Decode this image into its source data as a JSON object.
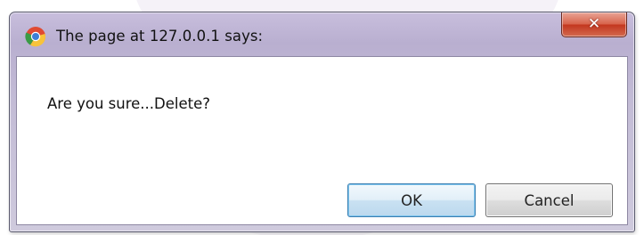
{
  "dialog": {
    "title": "The page at 127.0.0.1 says:",
    "message": "Are you sure...Delete?",
    "buttons": {
      "ok_label": "OK",
      "cancel_label": "Cancel"
    },
    "close_icon": "close-icon",
    "app_icon": "chrome-icon"
  },
  "colors": {
    "titlebar": "#c3bcd6",
    "close_button": "#c3371f",
    "ok_border": "#3c7fb1",
    "content_background": "#ffffff"
  }
}
